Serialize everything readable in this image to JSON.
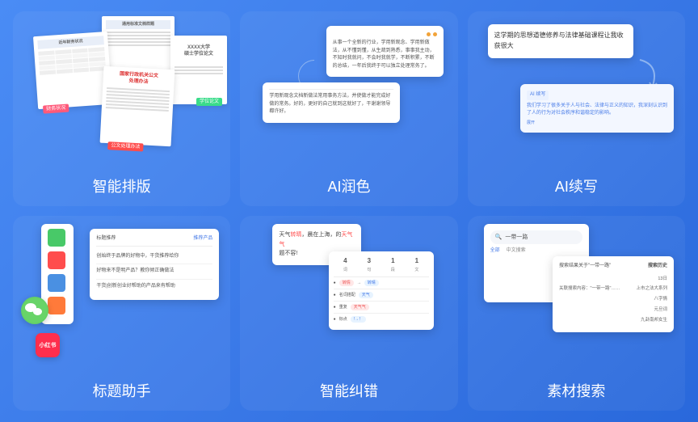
{
  "cards": {
    "layout": {
      "title": "智能排版",
      "doc1_header": "近年财务状况",
      "doc1_tag": "财务状况",
      "doc2_header": "通用标准文档样题",
      "doc3_header": "国家行政机关公文\n处理办法",
      "doc3_tag": "公文处理办法",
      "doc4_line1": "XXXX大学",
      "doc4_line2": "硕士学位论文"
    },
    "polish": {
      "title": "AI润色",
      "top_text": "从事一个全新的行业，学用新观念、学用新做法，从不懂到懂，从生疏到熟悉，事事我主动，不知时我就问，不会时我就学，不断积累，不断的总结，一年后我终于可以独立处理常务了。",
      "bottom_text": "学用新观念文档新做法常用事务方法，并使做才能完成好做的常务。好的，更好的自己就到这就好了，干谢谢领导都许好。"
    },
    "continue": {
      "title": "AI续写",
      "prompt_text": "这学期的思想道德修养与法律基础课程让我收获很大",
      "ai_badge": "AI 续写",
      "output_text": "我们学习了很多关于人与社会、法律与正义的知识，我深刻认识到了人的行为对社会秩序和谐稳定的影响。",
      "expand": "展开"
    },
    "titlehelper": {
      "title": "标题助手",
      "xhs_label": "小红书",
      "panel_header": "标题推荐",
      "tab_label": "推荐产品",
      "items": [
        "创始终于品牌的好物中，干货推荐给你",
        "好物来不是明产品？教你倾正确做法",
        "干货|创新创业好帮助的产品来有帮助"
      ]
    },
    "correct": {
      "title": "智能纠错",
      "sample_text_pre": "天气",
      "sample_text_err1": "转晴",
      "sample_text_mid": "，晨在上海，的",
      "sample_text_err2": "天气气",
      "sample_text_post": "题不容!",
      "counts": [
        "4",
        "3",
        "1",
        "1"
      ],
      "labels": [
        "词",
        "句",
        "段",
        "文"
      ],
      "rows": [
        {
          "a": "转情",
          "b": "转晴"
        },
        {
          "a": "名词搭配",
          "b": "天气"
        },
        {
          "a": "重复",
          "b": "天气气"
        },
        {
          "a": "标点",
          "b": "!→！"
        }
      ]
    },
    "search": {
      "title": "素材搜索",
      "query": "一带一路",
      "tab_main": "全部",
      "tab_sub": "中文搜索",
      "result_heading": "搜索结果关于\"一带一路\"",
      "history_label": "搜索历史",
      "history_items": [
        "13日",
        "上市之法大系列",
        "八字情",
        "元旦词",
        "九卦南邦女生"
      ],
      "footnote": "关联搜索内容：\"一带一路\"……"
    }
  }
}
